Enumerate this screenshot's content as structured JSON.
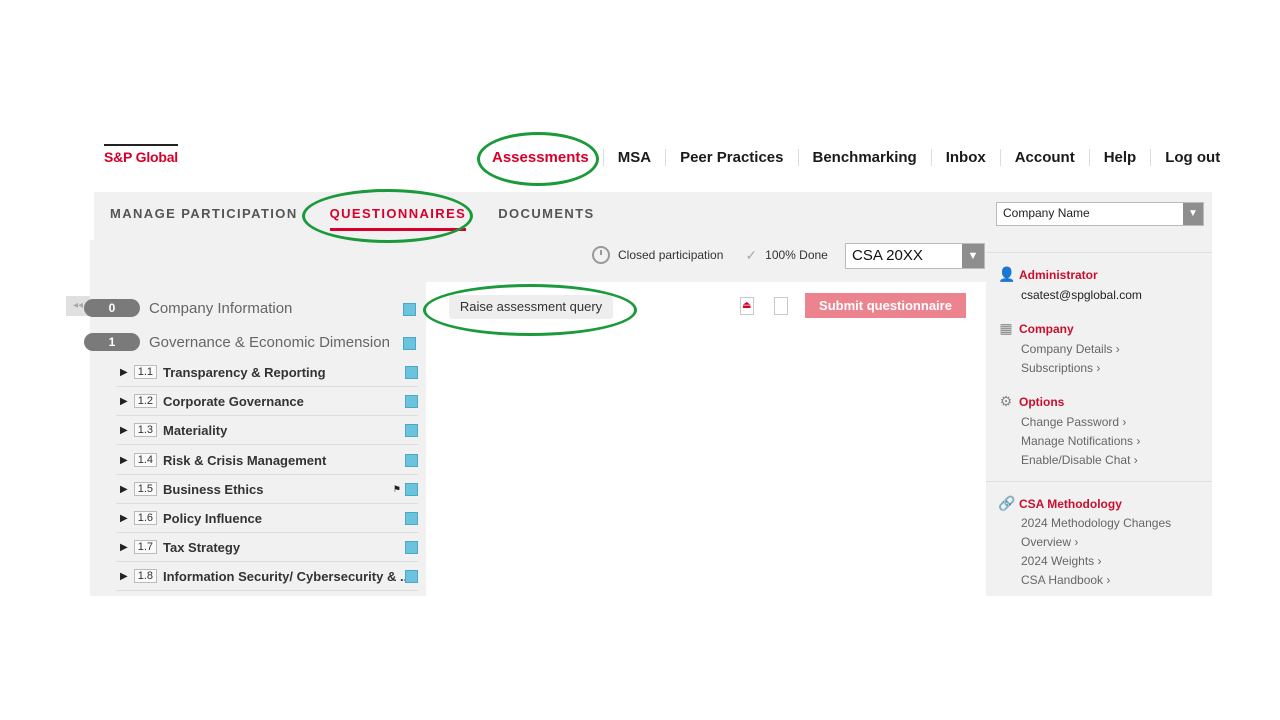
{
  "brand": {
    "logo_text": "S&P Global",
    "accent": "#d6002a",
    "highlight_ring": "#1a9a3a"
  },
  "top_nav": [
    "Assessments",
    "MSA",
    "Peer Practices",
    "Benchmarking",
    "Inbox",
    "Account",
    "Help",
    "Log out"
  ],
  "sub_nav": [
    "MANAGE PARTICIPATION",
    "QUESTIONNAIRES",
    "DOCUMENTS"
  ],
  "status": {
    "participation": "Closed participation",
    "done": "100% Done",
    "questionnaire_select": "CSA 20XX"
  },
  "sidebar": {
    "company_select": "Company Name",
    "admin": {
      "heading": "Administrator",
      "email": "csatest@spglobal.com"
    },
    "company": {
      "heading": "Company",
      "links": [
        "Company Details ›",
        "Subscriptions ›"
      ]
    },
    "options": {
      "heading": "Options",
      "links": [
        "Change Password ›",
        "Manage Notifications ›",
        "Enable/Disable Chat ›"
      ]
    },
    "methodology": {
      "heading": "CSA Methodology",
      "links": [
        "2024 Methodology Changes",
        "Overview ›",
        "2024 Weights ›",
        "CSA Handbook ›"
      ]
    }
  },
  "tree": {
    "collapse_label": "◂◂",
    "sections": [
      {
        "num": "0",
        "label": "Company Information"
      },
      {
        "num": "1",
        "label": "Governance & Economic Dimension"
      }
    ],
    "items": [
      {
        "num": "1.1",
        "label": "Transparency & Reporting"
      },
      {
        "num": "1.2",
        "label": "Corporate Governance"
      },
      {
        "num": "1.3",
        "label": "Materiality"
      },
      {
        "num": "1.4",
        "label": "Risk & Crisis Management"
      },
      {
        "num": "1.5",
        "label": "Business Ethics"
      },
      {
        "num": "1.6",
        "label": "Policy Influence"
      },
      {
        "num": "1.7",
        "label": "Tax Strategy"
      },
      {
        "num": "1.8",
        "label": "Information Security/ Cybersecurity & ..."
      }
    ]
  },
  "actions": {
    "query": "Raise assessment query",
    "submit": "Submit questionnaire",
    "pdf_icon_label": "⏏"
  }
}
